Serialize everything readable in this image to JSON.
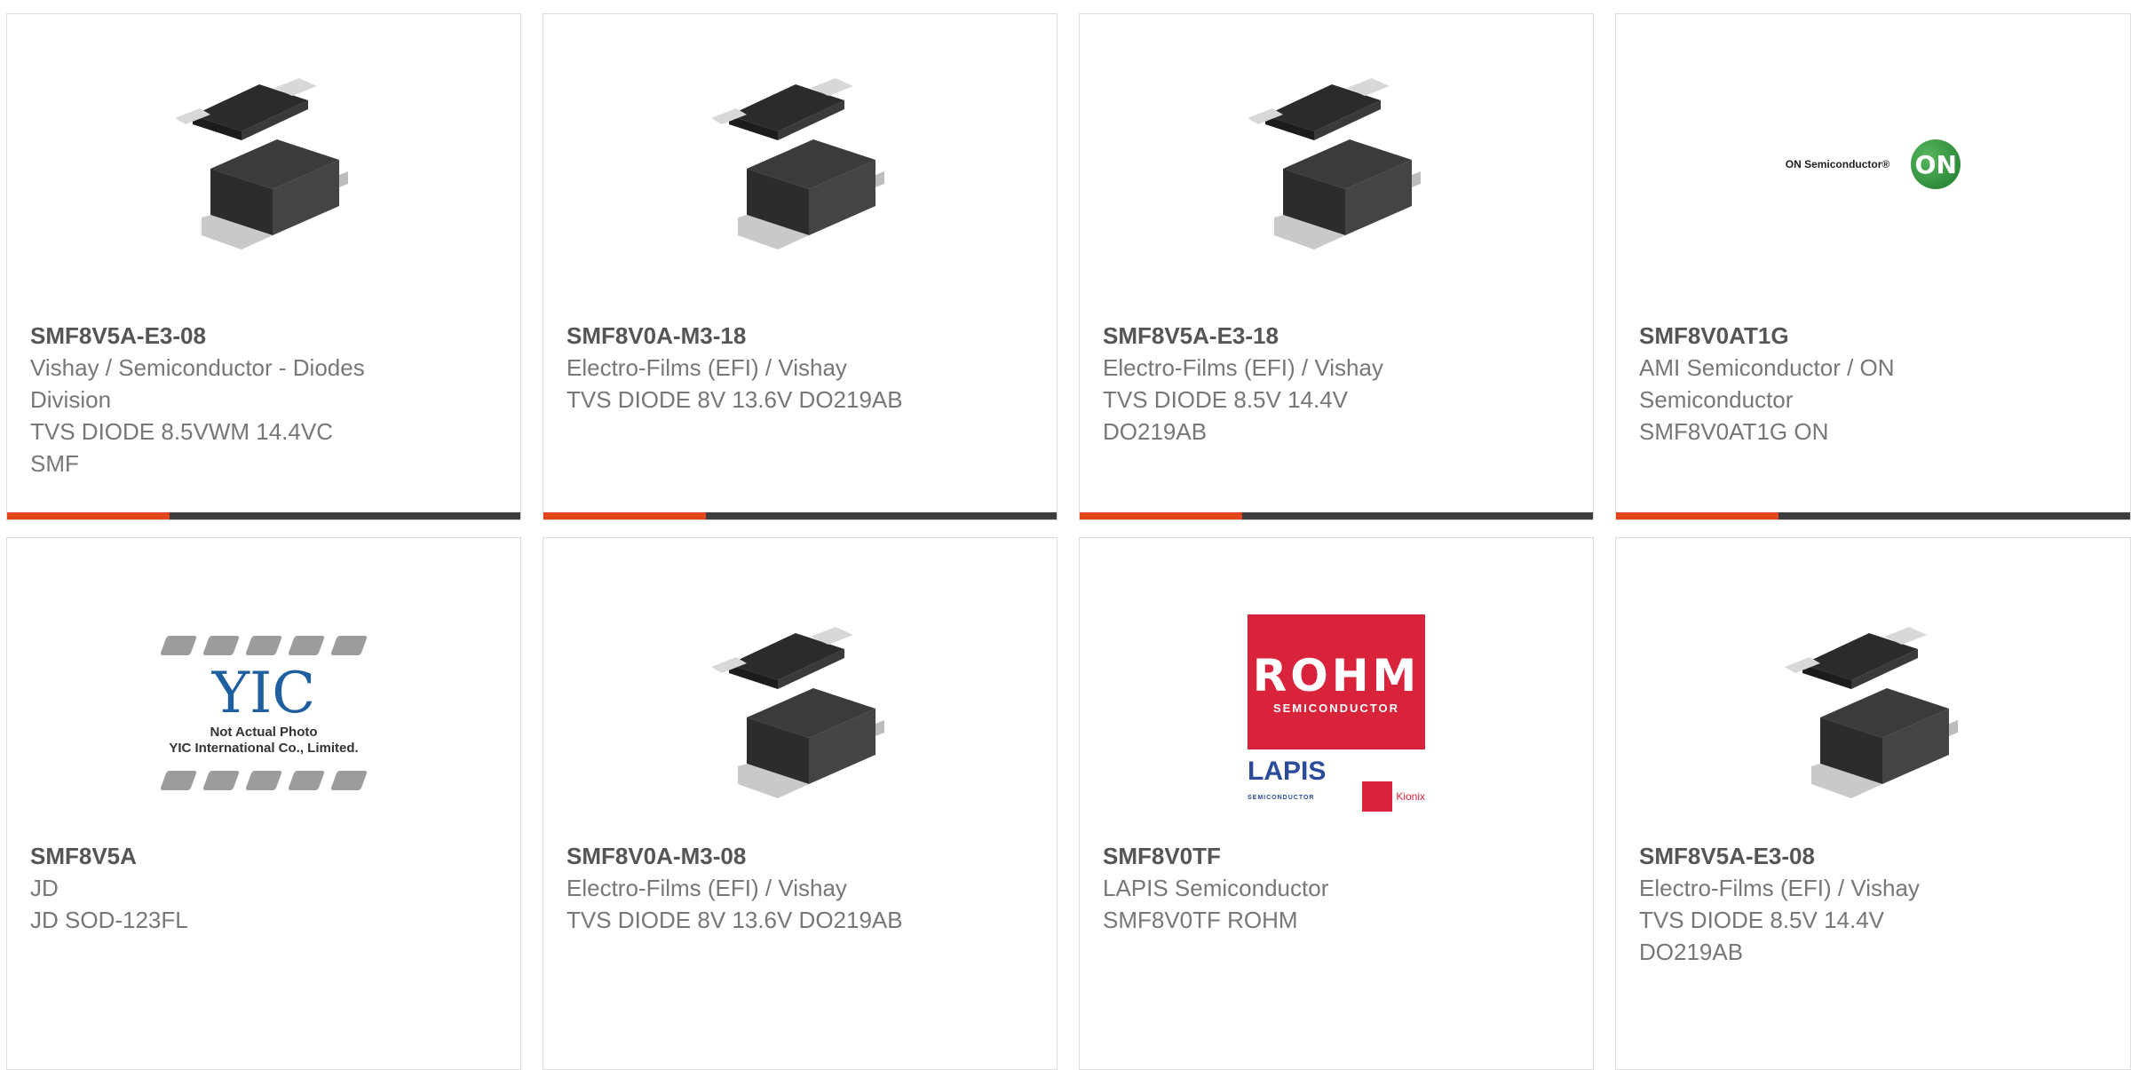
{
  "products": [
    {
      "part": "SMF8V5A-E3-08",
      "manufacturer": "Vishay / Semiconductor - Diodes\nDivision",
      "description": "TVS DIODE 8.5VWM 14.4VC\nSMF",
      "image": "diode-package-image"
    },
    {
      "part": "SMF8V0A-M3-18",
      "manufacturer": "Electro-Films (EFI) / Vishay",
      "description": "TVS DIODE 8V 13.6V DO219AB",
      "image": "diode-package-image"
    },
    {
      "part": "SMF8V5A-E3-18",
      "manufacturer": "Electro-Films (EFI) / Vishay",
      "description": "TVS DIODE 8.5V 14.4V\nDO219AB",
      "image": "diode-package-image"
    },
    {
      "part": "SMF8V0AT1G",
      "manufacturer": "AMI Semiconductor / ON\nSemiconductor",
      "description": "SMF8V0AT1G ON",
      "image": "on-semiconductor-logo"
    },
    {
      "part": "SMF8V5A",
      "manufacturer": "JD",
      "description": "JD SOD-123FL",
      "image": "yic-not-actual-photo"
    },
    {
      "part": "SMF8V0A-M3-08",
      "manufacturer": "Electro-Films (EFI) / Vishay",
      "description": "TVS DIODE 8V 13.6V DO219AB",
      "image": "diode-package-image"
    },
    {
      "part": "SMF8V0TF",
      "manufacturer": "LAPIS Semiconductor",
      "description": "SMF8V0TF ROHM",
      "image": "rohm-logo"
    },
    {
      "part": "SMF8V5A-E3-08",
      "manufacturer": "Electro-Films (EFI) / Vishay",
      "description": "TVS DIODE 8.5V 14.4V\nDO219AB",
      "image": "diode-package-image"
    }
  ],
  "logos": {
    "on_text": "ON Semiconductor®",
    "on_mark": "ON",
    "rohm_big": "ROHM",
    "rohm_small": "SEMICONDUCTOR",
    "lapis": "LAPIS",
    "lapis_small": "SEMICONDUCTOR",
    "kionix": "Kionix",
    "yic_mark": "YIC",
    "yic_note_1": "Not Actual Photo",
    "yic_note_2": "YIC International Co., Limited."
  },
  "colors": {
    "accent": "#e5451b",
    "bar": "#3d3d3d",
    "border": "#dcdcdc"
  }
}
